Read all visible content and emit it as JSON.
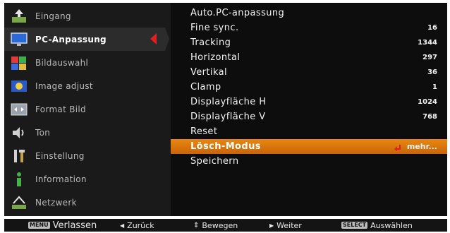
{
  "left_menu": {
    "items": [
      {
        "label": "Eingang",
        "icon": "input-icon"
      },
      {
        "label": "PC-Anpassung",
        "icon": "pc-monitor-icon",
        "active": true
      },
      {
        "label": "Bildauswahl",
        "icon": "image-select-icon"
      },
      {
        "label": "Image adjust",
        "icon": "image-adjust-icon"
      },
      {
        "label": "Format Bild",
        "icon": "screen-format-icon"
      },
      {
        "label": "Ton",
        "icon": "speaker-icon"
      },
      {
        "label": "Einstellung",
        "icon": "tools-icon"
      },
      {
        "label": "Information",
        "icon": "info-icon"
      },
      {
        "label": "Netzwerk",
        "icon": "network-icon"
      }
    ]
  },
  "right_panel": {
    "rows": [
      {
        "name": "Auto.PC-anpassung",
        "value": ""
      },
      {
        "name": "Fine sync.",
        "value": "16"
      },
      {
        "name": "Tracking",
        "value": "1344"
      },
      {
        "name": "Horizontal",
        "value": "297"
      },
      {
        "name": "Vertikal",
        "value": "36"
      },
      {
        "name": "Clamp",
        "value": "1"
      },
      {
        "name": "Displayfläche H",
        "value": "1024"
      },
      {
        "name": "Displayfläche V",
        "value": "768"
      },
      {
        "name": "Reset",
        "value": ""
      },
      {
        "name": "Lösch-Modus",
        "value": "mehr...",
        "selected": true
      },
      {
        "name": "Speichern",
        "value": ""
      }
    ]
  },
  "status_bar": {
    "menu_key": "MENU",
    "exit_label": "Verlassen",
    "back_label": "Zurück",
    "move_label": "Bewegen",
    "next_label": "Weiter",
    "select_key": "SELECT",
    "select_label": "Auswählen"
  },
  "colors": {
    "accent": "#d8760d",
    "arrow": "#e02020"
  }
}
